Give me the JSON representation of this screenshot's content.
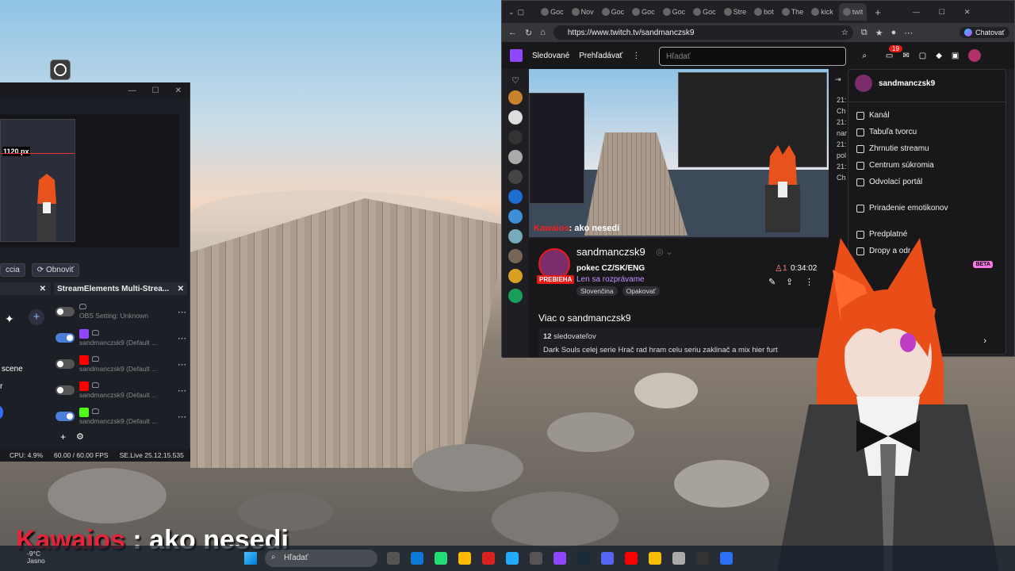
{
  "obs": {
    "btn_apply": "ccia",
    "btn_refresh": "Obnoviť",
    "preview_px_label": "1120 px",
    "dock_title": "StreamElements Multi-Strea...",
    "scene_label": "scene",
    "scene_sub": "r",
    "destinations": [
      {
        "name": "OBS Setting: Unknown",
        "on": false,
        "service": "",
        "color": ""
      },
      {
        "name": "sandmanczsk9 (Default ...",
        "on": true,
        "service": "twitch",
        "color": "#9147ff"
      },
      {
        "name": "sandmanczsk9 (Default ...",
        "on": false,
        "service": "youtube",
        "color": "#ff0000"
      },
      {
        "name": "sandmanczsk9 (Default ...",
        "on": false,
        "service": "youtube",
        "color": "#ff0000"
      },
      {
        "name": "sandmanczsk9 (Default ...",
        "on": true,
        "service": "kick",
        "color": "#53fc18"
      }
    ],
    "status": {
      "cpu": "CPU: 4.9%",
      "fps": "60.00 / 60.00 FPS",
      "version": "SE.Live 25.12.15.535"
    }
  },
  "browser": {
    "tabs": [
      "Goc",
      "Nov",
      "Goc",
      "Goc",
      "Goc",
      "Goc",
      "Stre",
      "bot",
      "The",
      "kick",
      "twit"
    ],
    "url": "https://www.twitch.tv/sandmanczsk9",
    "chat_button": "Chatovať",
    "nav": {
      "following": "Sledované",
      "browse": "Prehľadávať",
      "search_placeholder": "Hľadať",
      "notif_count": "19"
    },
    "video_sub_name": "Kawaios",
    "video_sub_text": ": ako nesedi",
    "channel": {
      "name": "sandmanczsk9",
      "live": "PREBIEHA",
      "title": "pokec CZ/SK/ENG",
      "category": "Len sa rozprávame",
      "tags": [
        "Slovenčina",
        "Opakovať"
      ],
      "viewers": "1",
      "uptime": "0:34:02",
      "about": "Viac o sandmanczsk9",
      "followers_count": "12",
      "followers_label": "sledovateľov",
      "description": "Dark Souls celej serie Hrač rad hram celu seriu zaklinač a mix hier furt"
    },
    "chat_times": [
      "21:",
      "Ch",
      "21:",
      "nar",
      "21:",
      "pol",
      "21:",
      "Ch"
    ],
    "menu": {
      "username": "sandmanczsk9",
      "items": [
        "Kanál",
        "Tabuľa tvorcu",
        "Zhrnutie streamu",
        "Centrum súkromia",
        "Odvolací portál",
        "Priradenie emotikonov",
        "Predplatné",
        "Dropy a odr"
      ],
      "beta": "BETA"
    }
  },
  "caption": {
    "name": "Kawaios",
    "text": " : ako nesedi"
  },
  "taskbar": {
    "temp": "-9°C",
    "weather": "Jasno",
    "search": "Hľadať",
    "icons": [
      "files",
      "edge",
      "store",
      "explorer",
      "acrobat",
      "vtuber",
      "vpn",
      "twitch",
      "steam",
      "discord",
      "youtube",
      "chrome",
      "stream",
      "obs",
      "app"
    ]
  }
}
